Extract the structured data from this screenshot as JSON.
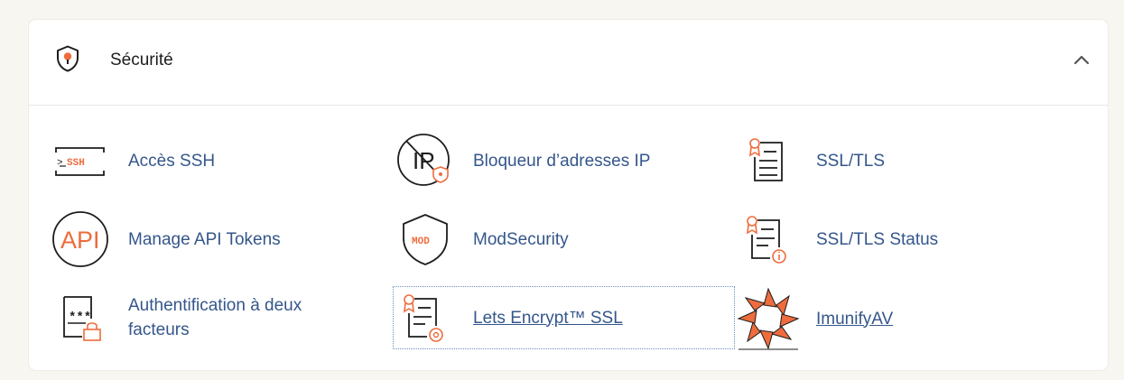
{
  "section": {
    "title": "Sécurité",
    "icon": "shield-pin-icon",
    "expanded": true
  },
  "colors": {
    "accent": "#ee6c3d",
    "link": "#34568b",
    "icon_stroke": "#1d1d1d",
    "background": "#f8f6f1"
  },
  "items": [
    {
      "label": "Accès SSH",
      "icon": "ssh-terminal-icon"
    },
    {
      "label": "Bloqueur d’adresses IP",
      "icon": "ip-blocker-icon"
    },
    {
      "label": "SSL/TLS",
      "icon": "certificate-icon"
    },
    {
      "label": "Manage API Tokens",
      "icon": "api-icon"
    },
    {
      "label": "ModSecurity",
      "icon": "modsecurity-shield-icon"
    },
    {
      "label": "SSL/TLS Status",
      "icon": "certificate-status-icon"
    },
    {
      "label": "Authentification à deux facteurs",
      "icon": "two-factor-lock-icon"
    },
    {
      "label": "Lets Encrypt™ SSL",
      "icon": "lets-encrypt-certificate-icon"
    },
    {
      "label": "ImunifyAV",
      "icon": "imunify-av-icon"
    }
  ]
}
